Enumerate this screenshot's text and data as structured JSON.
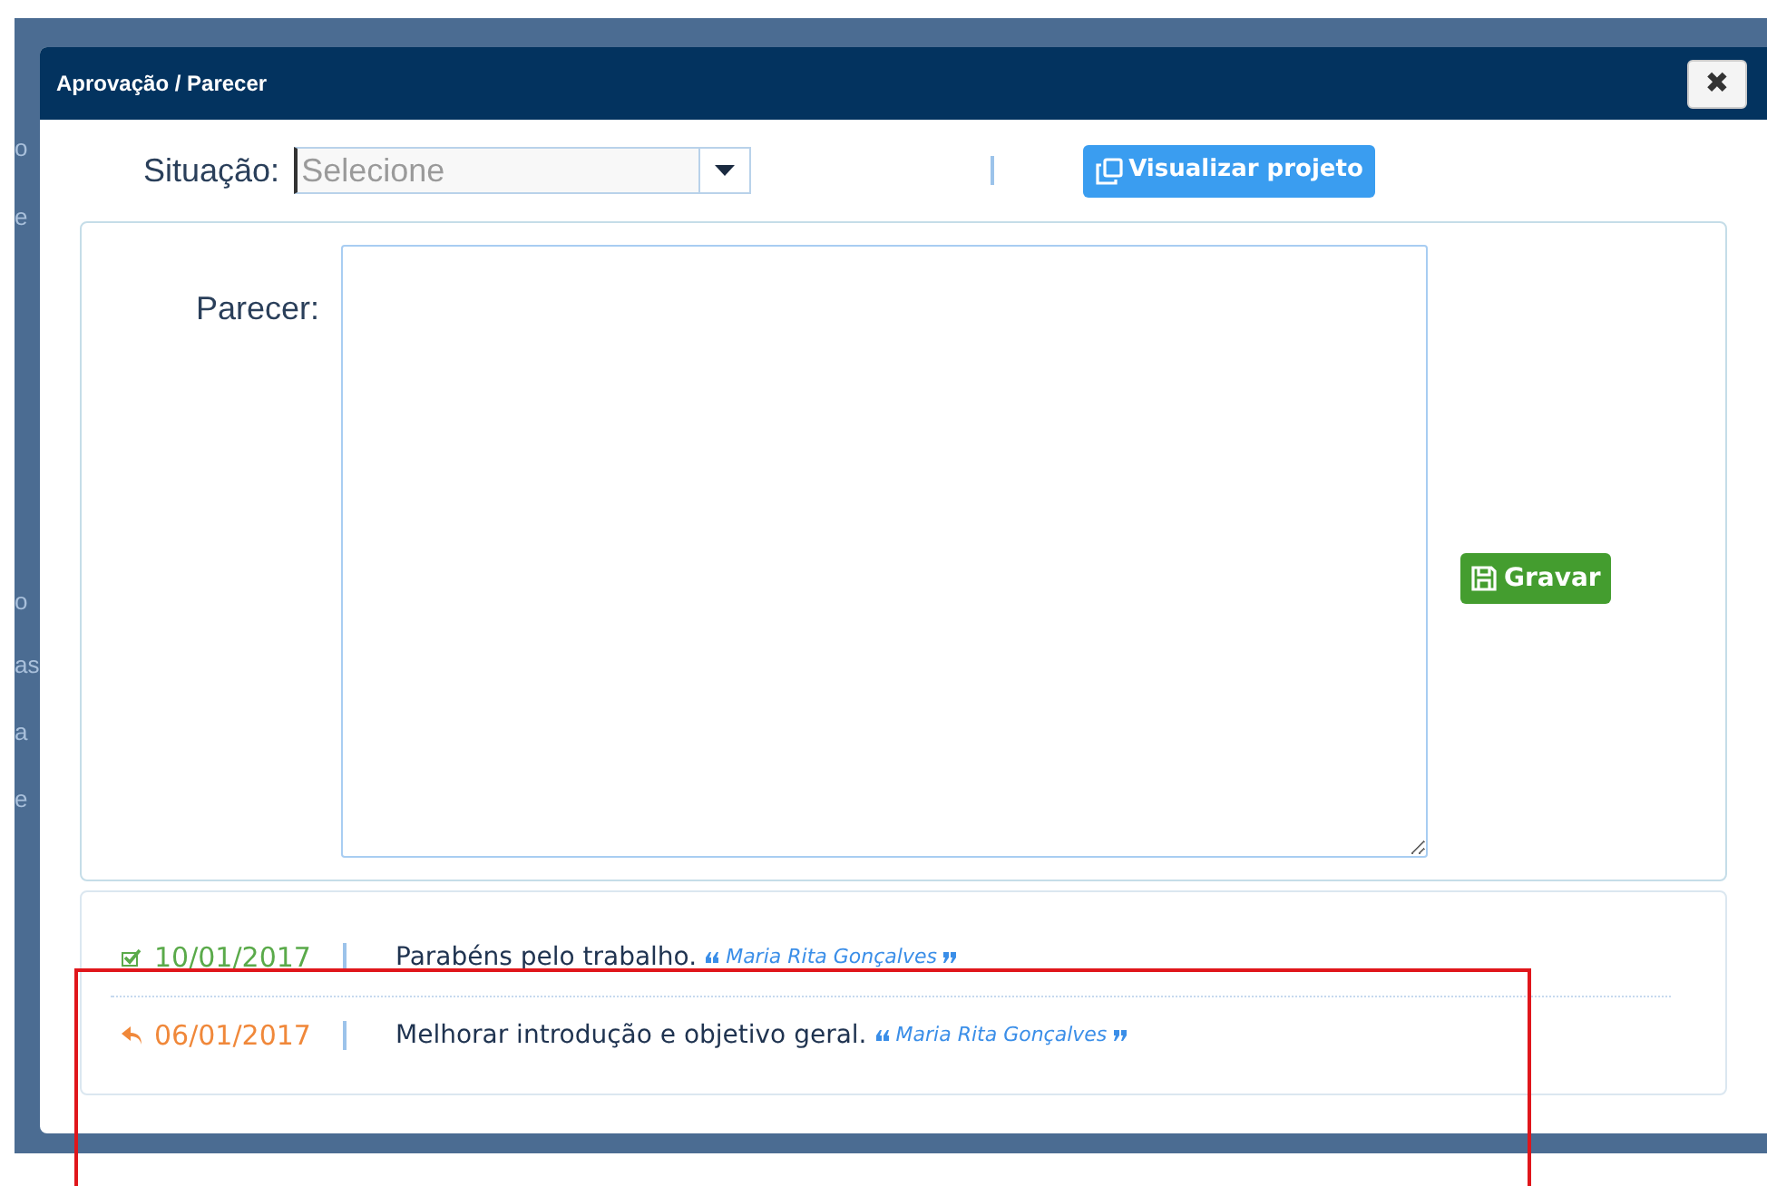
{
  "background_fragments": [
    "o",
    "e",
    "o",
    "as",
    "a",
    "e"
  ],
  "window": {
    "title": "Aprovação / Parecer",
    "close": "✖"
  },
  "situacao": {
    "label": "Situação:",
    "placeholder": "Selecione"
  },
  "view_button": {
    "label": "Visualizar projeto"
  },
  "parecer": {
    "label": "Parecer:"
  },
  "save_button": {
    "label": "Gravar"
  },
  "history": [
    {
      "kind": "approved",
      "date": "10/01/2017",
      "text": "Parabéns pelo trabalho.",
      "author": "Maria Rita Gonçalves"
    },
    {
      "kind": "returned",
      "date": "06/01/2017",
      "text": "Melhorar introdução e objetivo geral.",
      "author": "Maria Rita Gonçalves"
    }
  ],
  "highlight": {
    "kind": "frame"
  }
}
